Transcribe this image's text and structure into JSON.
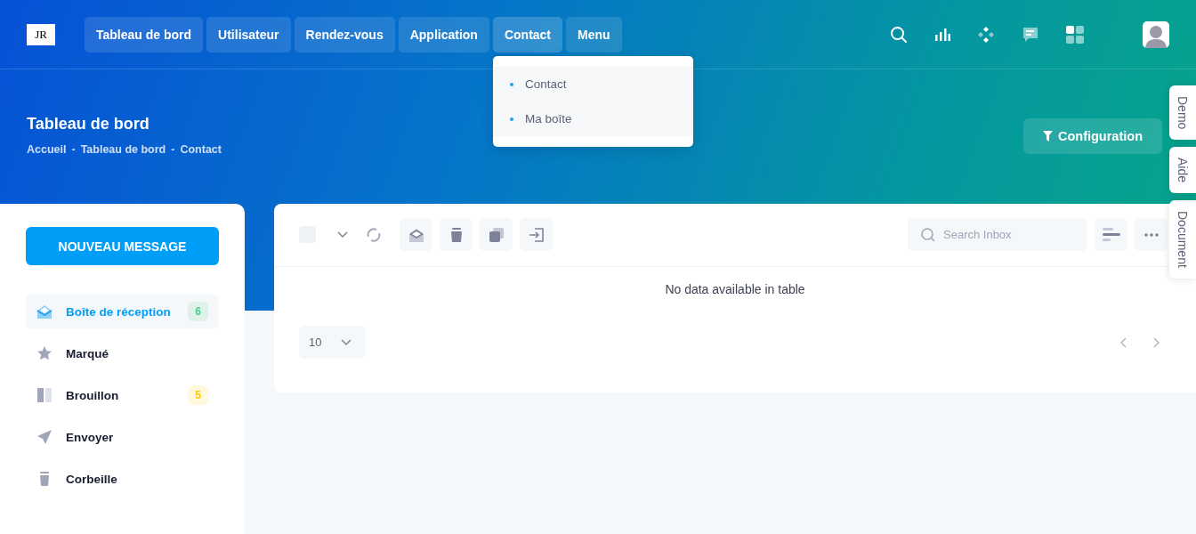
{
  "nav": {
    "items": [
      {
        "label": "Tableau de bord",
        "expanded": false
      },
      {
        "label": "Utilisateur",
        "expanded": false
      },
      {
        "label": "Rendez-vous",
        "expanded": false
      },
      {
        "label": "Application",
        "expanded": false
      },
      {
        "label": "Contact",
        "expanded": true,
        "children": [
          "Contact",
          "Ma boîte"
        ]
      },
      {
        "label": "Menu",
        "expanded": false
      }
    ]
  },
  "logo": {
    "text": "JR"
  },
  "page": {
    "title": "Tableau de bord",
    "breadcrumb": [
      "Accueil",
      "-",
      "Tableau de bord",
      "-",
      "Contact"
    ],
    "config_button": "Configuration"
  },
  "side_tabs": [
    "Demo",
    "Aide",
    "Document"
  ],
  "sidebar": {
    "compose": "NOUVEAU MESSAGE",
    "folders": [
      {
        "label": "Boîte de réception",
        "kind": "inbox",
        "selected": true,
        "badge": "6",
        "color": "#50cd89"
      },
      {
        "label": "Marqué",
        "kind": "star",
        "selected": false
      },
      {
        "label": "Brouillon",
        "kind": "draft",
        "selected": false,
        "badge": "5",
        "color": "#ffc700"
      },
      {
        "label": "Envoyer",
        "kind": "send",
        "selected": false
      },
      {
        "label": "Corbeille",
        "kind": "trash",
        "selected": false
      }
    ]
  },
  "inbox": {
    "select_all": {
      "checked": false
    },
    "search": {
      "placeholder": "Search Inbox"
    },
    "empty": "No data available in table",
    "page_size": "10"
  }
}
